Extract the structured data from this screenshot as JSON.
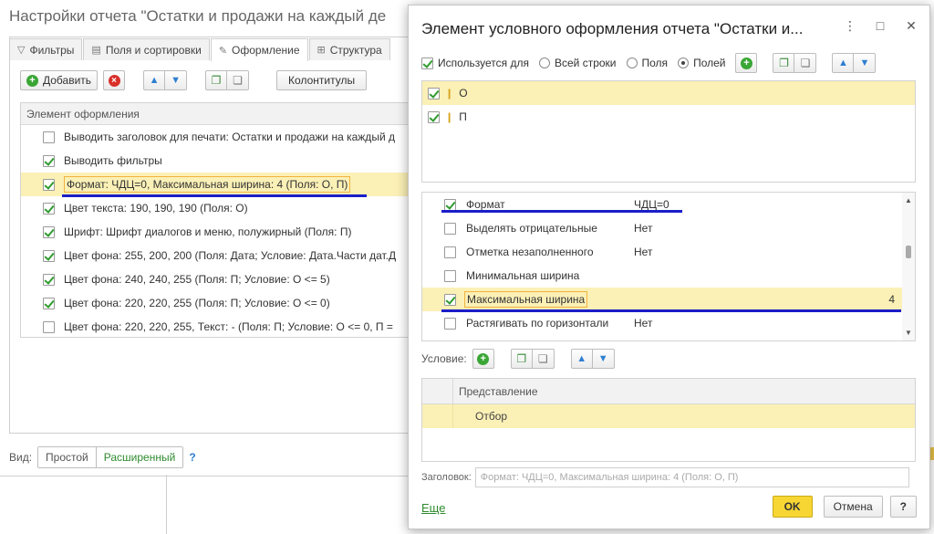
{
  "bg": {
    "title": "Настройки отчета \"Остатки и продажи на каждый де",
    "tabs": [
      {
        "icon": "▽",
        "label": "Фильтры"
      },
      {
        "icon": "▤",
        "label": "Поля и сортировки"
      },
      {
        "icon": "✎",
        "label": "Оформление"
      },
      {
        "icon": "⊞",
        "label": "Структура"
      }
    ],
    "toolbar": {
      "add_label": "Добавить",
      "headers_label": "Колонтитулы"
    },
    "list_header": "Элемент оформления",
    "rows": [
      {
        "checked": false,
        "text": "Выводить заголовок для печати: Остатки и продажи на каждый д"
      },
      {
        "checked": true,
        "text": "Выводить фильтры"
      },
      {
        "checked": true,
        "text": "Формат: ЧДЦ=0, Максимальная ширина: 4 (Поля: О, П)"
      },
      {
        "checked": true,
        "text": "Цвет текста: 190, 190, 190 (Поля: О)"
      },
      {
        "checked": true,
        "text": "Шрифт: Шрифт диалогов и меню, полужирный (Поля: П)"
      },
      {
        "checked": true,
        "text": "Цвет фона: 255, 200, 200 (Поля: Дата; Условие: Дата.Части дат.Д"
      },
      {
        "checked": true,
        "text": "Цвет фона: 240, 240, 255 (Поля: П; Условие: О <= 5)"
      },
      {
        "checked": true,
        "text": "Цвет фона: 220, 220, 255 (Поля: П; Условие: О <= 0)"
      },
      {
        "checked": false,
        "text": "Цвет фона: 220, 220, 255, Текст: - (Поля: П; Условие: О <= 0, П ="
      }
    ],
    "view_label": "Вид:",
    "view_simple": "Простой",
    "view_advanced": "Расширенный",
    "help": "?"
  },
  "dialog": {
    "title": "Элемент условного оформления отчета \"Остатки и...",
    "controls": {
      "menu": "⋮",
      "maximize": "□",
      "close": "✕"
    },
    "used_for_label": "Используется для",
    "radio_all_rows": "Всей строки",
    "radio_field": "Поля",
    "radio_fields": "Полей",
    "fields": [
      {
        "checked": true,
        "name": "О"
      },
      {
        "checked": true,
        "name": "П"
      }
    ],
    "props": [
      {
        "checked": true,
        "name": "Формат",
        "value": "ЧДЦ=0"
      },
      {
        "checked": false,
        "name": "Выделять отрицательные",
        "value": "Нет"
      },
      {
        "checked": false,
        "name": "Отметка незаполненного",
        "value": "Нет"
      },
      {
        "checked": false,
        "name": "Минимальная ширина",
        "value": ""
      },
      {
        "checked": true,
        "name": "Максимальная ширина",
        "value": "4"
      },
      {
        "checked": false,
        "name": "Растягивать по горизонтали",
        "value": "Нет"
      }
    ],
    "condition_label": "Условие:",
    "cond_header": "Представление",
    "cond_row": "Отбор",
    "header_label": "Заголовок:",
    "header_placeholder": "Формат: ЧДЦ=0, Максимальная ширина: 4 (Поля: О, П)",
    "more_link": "Еще",
    "ok": "OK",
    "cancel": "Отмена",
    "help": "?"
  },
  "colors": {
    "selection": "#fbf0b6",
    "accent_green": "#3aa635",
    "ok_yellow": "#f7d633",
    "underline_blue": "#1b1ec8"
  }
}
